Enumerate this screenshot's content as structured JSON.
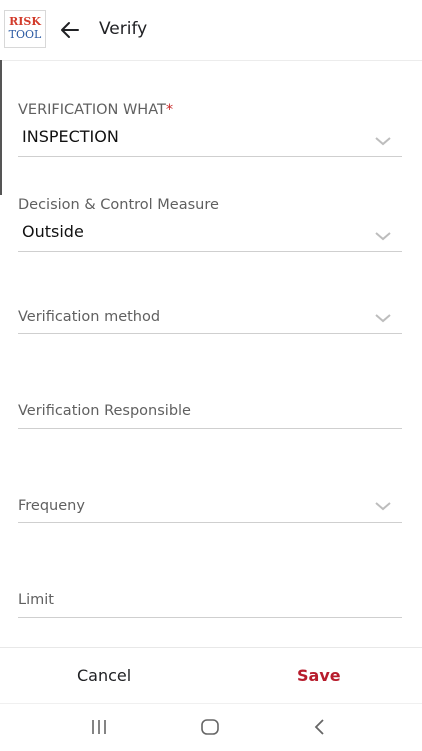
{
  "app": {
    "logo_line1": "RISK",
    "logo_line2": "TOOL",
    "title": "Verify"
  },
  "icons": {
    "back": "arrow-left-icon",
    "chevron": "chevron-down-icon"
  },
  "fields": {
    "verification_what": {
      "label": "VERIFICATION WHAT",
      "required_mark": "*",
      "value": "INSPECTION"
    },
    "decision_control": {
      "label": "Decision & Control Measure",
      "value": "Outside"
    },
    "verification_method": {
      "label": "Verification method"
    },
    "verification_responsible": {
      "label": "Verification Responsible"
    },
    "frequency": {
      "label": "Frequeny"
    },
    "limit": {
      "label": "Limit"
    }
  },
  "footer": {
    "cancel": "Cancel",
    "save": "Save"
  },
  "system_nav": {
    "recent": "recents-icon",
    "home": "home-icon",
    "back": "back-icon"
  },
  "colors": {
    "accent_save": "#b71c2c",
    "required": "#c62828"
  }
}
